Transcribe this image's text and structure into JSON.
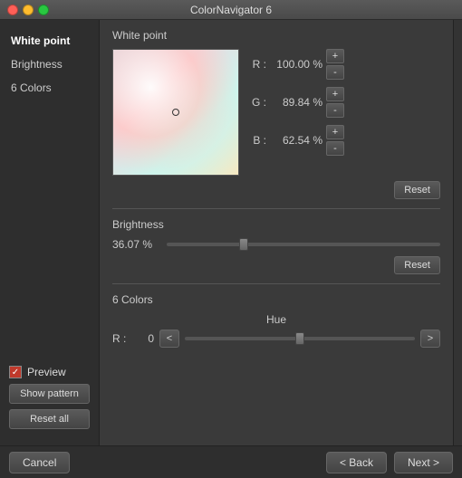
{
  "window": {
    "title": "ColorNavigator 6"
  },
  "sidebar": {
    "items": [
      {
        "label": "White point",
        "active": true
      },
      {
        "label": "Brightness",
        "active": false
      },
      {
        "label": "6 Colors",
        "active": false
      }
    ],
    "preview_label": "Preview",
    "show_pattern_label": "Show pattern",
    "reset_all_label": "Reset all"
  },
  "white_point": {
    "section_title": "White point",
    "R_label": "R :",
    "R_value": "100.00 %",
    "G_label": "G :",
    "G_value": "89.84 %",
    "B_label": "B :",
    "B_value": "62.54 %",
    "plus_label": "+",
    "minus_label": "-",
    "reset_label": "Reset"
  },
  "brightness": {
    "section_title": "Brightness",
    "value": "36.07 %",
    "slider_position_pct": 28,
    "reset_label": "Reset"
  },
  "six_colors": {
    "section_title": "6 Colors",
    "hue_label": "Hue",
    "R_label": "R :",
    "R_value": "0",
    "left_arrow": "<",
    "right_arrow": ">",
    "slider_position_pct": 50
  },
  "bottom_bar": {
    "cancel_label": "Cancel",
    "back_label": "< Back",
    "next_label": "Next >"
  }
}
